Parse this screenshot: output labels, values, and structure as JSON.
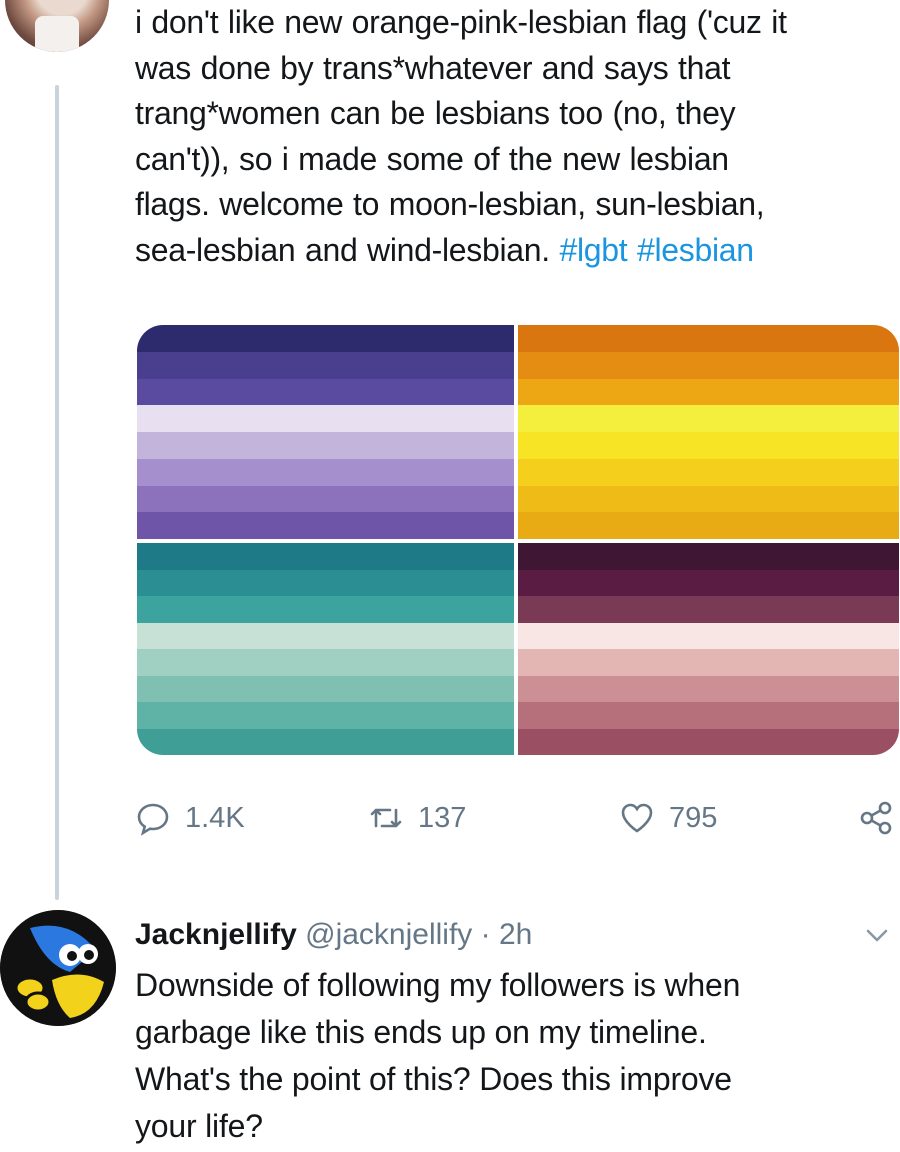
{
  "tweet": {
    "text": "i don't like new orange-pink-lesbian flag ('cuz it\nwas done by trans*whatever and says that\ntrang*women can be lesbians too (no, they\ncan't)), so i made some of the new lesbian\nflags. welcome to moon-lesbian, sun-lesbian,\nsea-lesbian and wind-lesbian. ",
    "hashtags": "#lgbt #lesbian",
    "flags": [
      {
        "name": "moon",
        "stripes": [
          "#2e2a6e",
          "#4a3f8f",
          "#5a4ba1",
          "#e8dff0",
          "#c3b4dc",
          "#a68fcd",
          "#8c72bd",
          "#6e55a8"
        ]
      },
      {
        "name": "sun",
        "stripes": [
          "#d9760f",
          "#e58c12",
          "#eda614",
          "#f4ef3c",
          "#f7e424",
          "#f4d01c",
          "#efbb16",
          "#e9ab14"
        ]
      },
      {
        "name": "sea",
        "stripes": [
          "#1e7a86",
          "#2a8e92",
          "#3ca39e",
          "#c8e1d6",
          "#9fd0c2",
          "#7fc0b3",
          "#5eb2a6",
          "#3f9f97"
        ]
      },
      {
        "name": "wind",
        "stripes": [
          "#3f1734",
          "#5b1c44",
          "#7a3a55",
          "#f7e6e4",
          "#e3b6b4",
          "#cc8f93",
          "#b5707c",
          "#9b4f63"
        ]
      }
    ],
    "actions": {
      "replies": "1.4K",
      "retweets": "137",
      "likes": "795"
    }
  },
  "reply": {
    "name": "Jacknjellify",
    "handle_time": "@jacknjellify · 2h",
    "text": "Downside of following my followers is when\ngarbage like this ends up on my timeline.\nWhat's the point of this? Does this improve\nyour life?"
  },
  "icons": {
    "reply": "reply-icon",
    "retweet": "retweet-icon",
    "like": "heart-icon",
    "share": "share-icon",
    "more": "chevron-down-icon"
  }
}
